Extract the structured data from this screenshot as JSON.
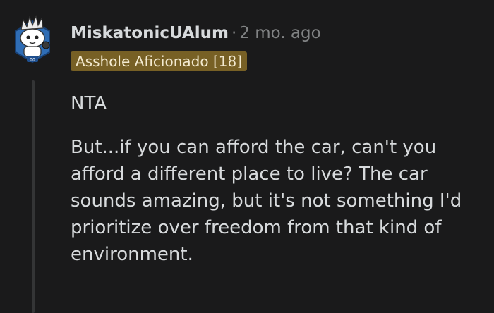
{
  "comment": {
    "username": "MiskatonicUAlum",
    "separator": "·",
    "timestamp": "2 mo. ago",
    "flair": "Asshole Aficionado [18]",
    "paragraphs": [
      "NTA",
      "But...if you can afford the car, can't you afford a different place to live? The car sounds amazing, but it's not something I'd prioritize over freedom from that kind of environment."
    ]
  },
  "colors": {
    "background": "#1a1a1b",
    "text": "#d7dadc",
    "muted": "#818384",
    "flair_bg": "#776025",
    "thread_line": "#343536"
  },
  "icons": {
    "avatar": "snoo-avatar-icon"
  }
}
